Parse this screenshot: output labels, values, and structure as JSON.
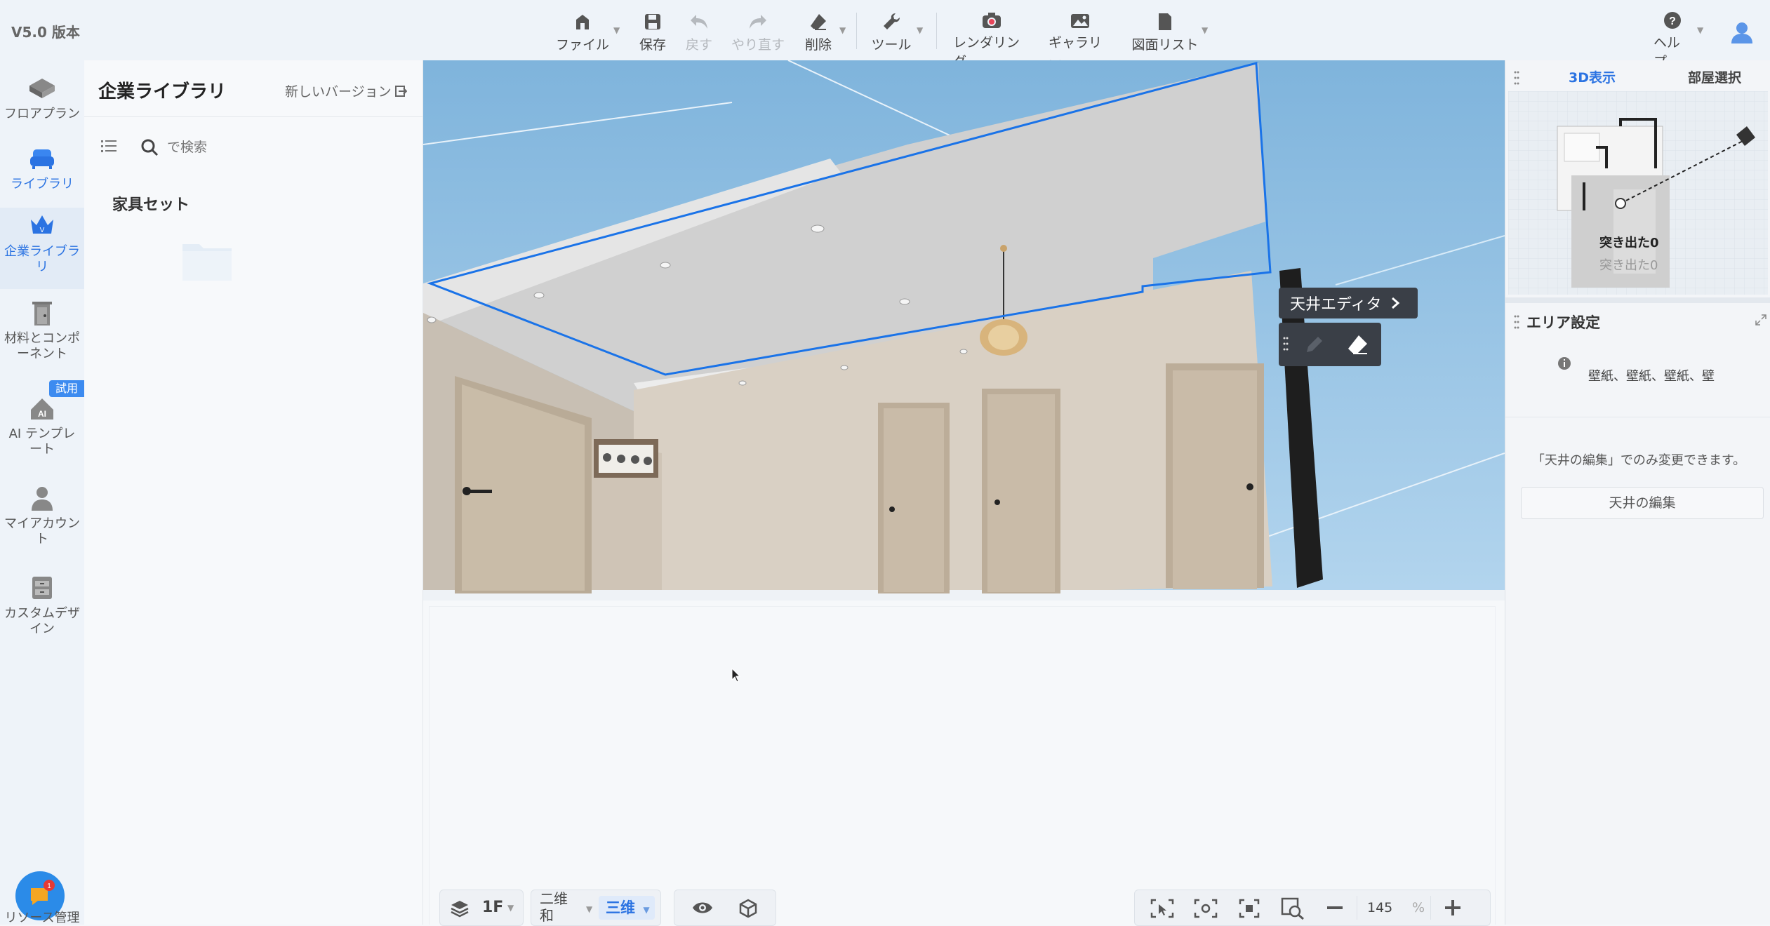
{
  "app": {
    "version": "V5.0 版本"
  },
  "toolbar": {
    "file": "ファイル",
    "save": "保存",
    "undo": "戻す",
    "redo": "やり直す",
    "delete": "削除",
    "tools": "ツール",
    "rendering": "レンダリング",
    "gallery": "ギャラリー",
    "drawing_list": "図面リスト",
    "help": "ヘルプ"
  },
  "sidebar": {
    "items": [
      {
        "label": "フロアプラン",
        "icon": "floorplan-icon"
      },
      {
        "label": "ライブラリ",
        "icon": "sofa-icon"
      },
      {
        "label": "企業ライブラリ",
        "icon": "crown-icon"
      },
      {
        "label": "材料とコンポーネント",
        "icon": "door-icon"
      },
      {
        "label": "AI テンプレート",
        "icon": "ai-template-icon",
        "badge": "試用"
      },
      {
        "label": "マイアカウント",
        "icon": "user-icon"
      },
      {
        "label": "カスタムデザイン",
        "icon": "cabinet-icon"
      }
    ],
    "bottom_label": "リソース管理"
  },
  "library": {
    "title": "企業ライブラリ",
    "new_version": "新しいバージョン",
    "search_placeholder": "で検索",
    "section": "家具セット"
  },
  "viewport": {
    "ceiling_editor": "天井エディタ"
  },
  "bottombar": {
    "floor": "1F",
    "view_2d": "二维",
    "view_2d_sub": "和",
    "view_3d": "三维",
    "zoom_value": "145",
    "zoom_unit": "%"
  },
  "right": {
    "tab_3d": "3D表示",
    "tab_room": "部屋選択",
    "minimap_label1": "突き出た0",
    "minimap_label2": "突き出た0",
    "area_title": "エリア設定",
    "wall_text": "壁紙、壁紙、壁紙、壁",
    "hint": "「天井の編集」でのみ変更できます。",
    "edit_ceiling": "天井の編集"
  },
  "colors": {
    "accent": "#2b73e2",
    "selection": "#1a73e8",
    "badge": "#3d8bf0"
  }
}
